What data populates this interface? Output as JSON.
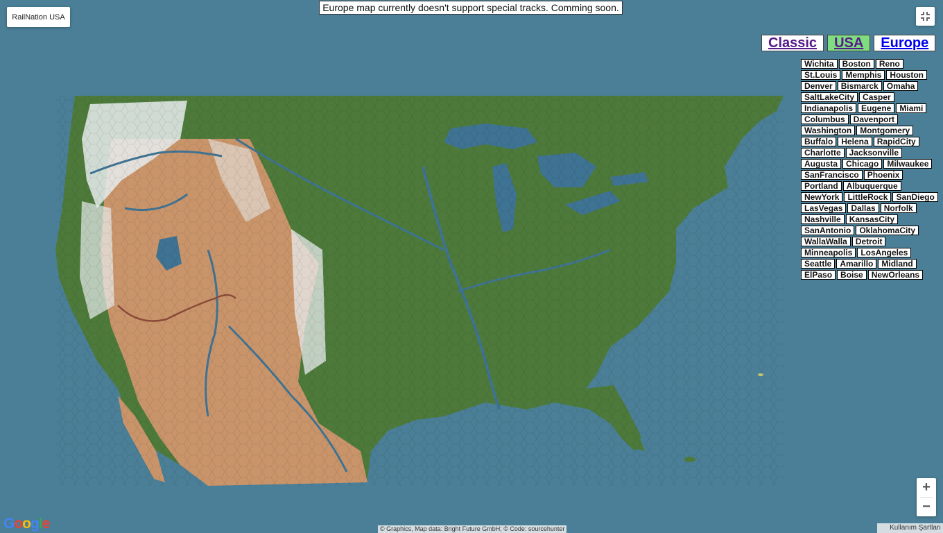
{
  "title_button": "RailNation USA",
  "notice": "Europe map currently doesn't support special tracks. Comming soon.",
  "modes": [
    {
      "label": "Classic",
      "state": "visited"
    },
    {
      "label": "USA",
      "state": "active"
    },
    {
      "label": "Europe",
      "state": "link"
    }
  ],
  "city_rows": [
    [
      "Wichita",
      "Boston",
      "Reno"
    ],
    [
      "St.Louis",
      "Memphis",
      "Houston"
    ],
    [
      "Denver",
      "Bismarck",
      "Omaha"
    ],
    [
      "SaltLakeCity",
      "Casper"
    ],
    [
      "Indianapolis",
      "Eugene",
      "Miami"
    ],
    [
      "Columbus",
      "Davenport"
    ],
    [
      "Washington",
      "Montgomery"
    ],
    [
      "Buffalo",
      "Helena",
      "RapidCity"
    ],
    [
      "Charlotte",
      "Jacksonville"
    ],
    [
      "Augusta",
      "Chicago",
      "Milwaukee"
    ],
    [
      "SanFrancisco",
      "Phoenix"
    ],
    [
      "Portland",
      "Albuquerque"
    ],
    [
      "NewYork",
      "LittleRock",
      "SanDiego"
    ],
    [
      "LasVegas",
      "Dallas",
      "Norfolk"
    ],
    [
      "Nashville",
      "KansasCity"
    ],
    [
      "SanAntonio",
      "OklahomaCity"
    ],
    [
      "WallaWalla",
      "Detroit"
    ],
    [
      "Minneapolis",
      "LosAngeles"
    ],
    [
      "Seattle",
      "Amarillo",
      "Midland"
    ],
    [
      "ElPaso",
      "Boise",
      "NewOrleans"
    ]
  ],
  "zoom": {
    "in": "+",
    "out": "−"
  },
  "google_logo": "Google",
  "attribution": "© Graphics, Map data: Bright Future GmbH; © Code: sourcehunter",
  "terms": "Kullanım Şartları",
  "colors": {
    "ocean": "#4a7f97",
    "land": "#4d7a3a",
    "desert": "#c9946a",
    "snow": "#e8ecef",
    "lake": "#3f7393",
    "active_mode": "#7fdc7f"
  },
  "icons": [
    "fullscreen-exit-icon",
    "zoom-in-icon",
    "zoom-out-icon"
  ]
}
